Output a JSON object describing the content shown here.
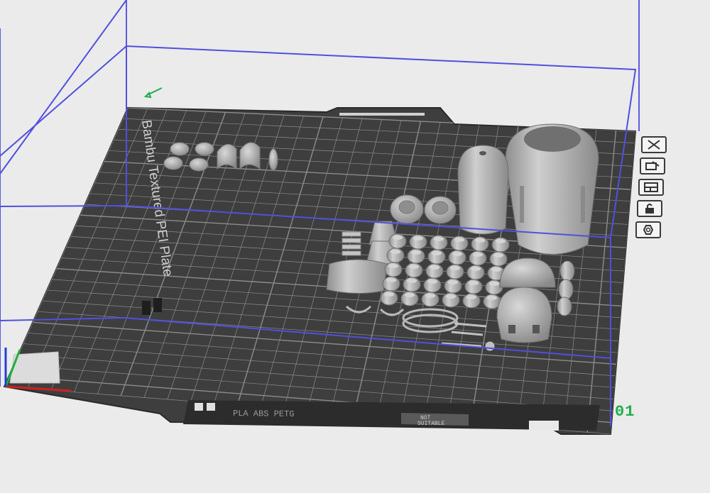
{
  "plate": {
    "label": "Bambu Textured PEI Plate",
    "number": "01",
    "bed_color": "#3e3e3e",
    "grid_color": "#8c8c8c",
    "bound_color": "#5050e0"
  },
  "bottom_strip": {
    "filaments": "PLA ABS PETG",
    "status_line1": "NOT",
    "status_line2": "SUITABLE"
  },
  "side_toolbar": {
    "buttons": [
      "close-icon",
      "auto-orient-icon",
      "arrange-icon",
      "lock-icon",
      "settings-icon"
    ]
  },
  "colors": {
    "model": "#b4b4b4",
    "accent_green": "#1fae4b"
  }
}
